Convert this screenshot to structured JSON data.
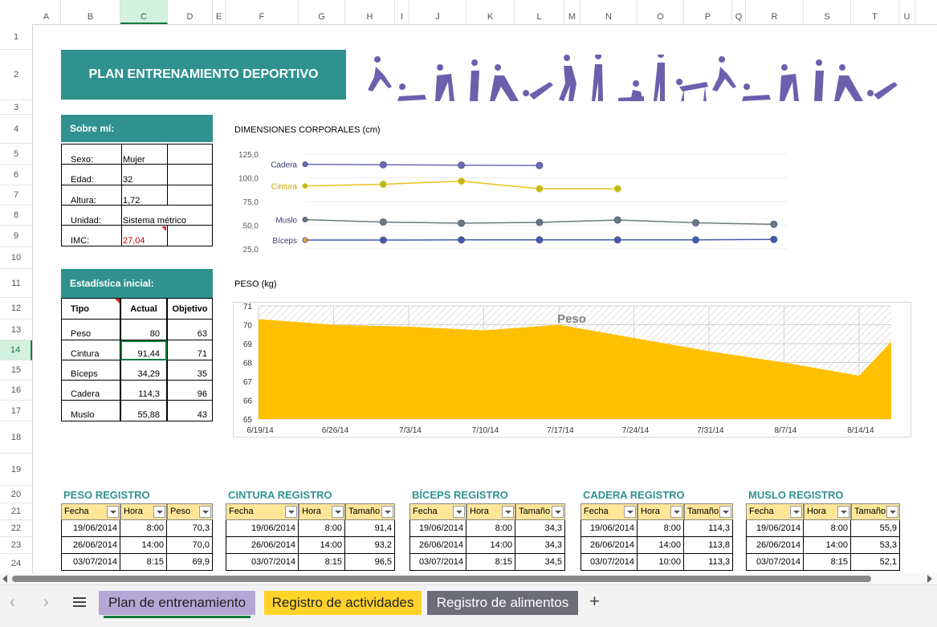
{
  "columns": [
    "A",
    "B",
    "C",
    "D",
    "E",
    "F",
    "G",
    "H",
    "I",
    "J",
    "K",
    "L",
    "M",
    "N",
    "O",
    "P",
    "Q",
    "R",
    "S",
    "T",
    "U"
  ],
  "rows": [
    "1",
    "2",
    "3",
    "4",
    "5",
    "6",
    "7",
    "8",
    "9",
    "10",
    "11",
    "12",
    "13",
    "14",
    "15",
    "16",
    "17",
    "18",
    "19",
    "20",
    "21",
    "22",
    "23",
    "24"
  ],
  "banner": {
    "title": "PLAN ENTRENAMIENTO DEPORTIVO"
  },
  "about": {
    "title": "Sobre mí:",
    "rows": [
      {
        "label": "Sexo:",
        "value": "Mujer"
      },
      {
        "label": "Edad:",
        "value": "32"
      },
      {
        "label": "Altura:",
        "value": "1,72"
      },
      {
        "label": "Unidad:",
        "value": "Sistema métrico"
      },
      {
        "label": "IMC:",
        "value": "27,04"
      }
    ]
  },
  "stats": {
    "title": "Estadística inicial:",
    "headers": [
      "Tipo",
      "Actual",
      "Objetivo"
    ],
    "rows": [
      {
        "tipo": "Peso",
        "actual": "80",
        "objetivo": "63"
      },
      {
        "tipo": "Cintura",
        "actual": "91,44",
        "objetivo": "71"
      },
      {
        "tipo": "Bíceps",
        "actual": "34,29",
        "objetivo": "35"
      },
      {
        "tipo": "Cadera",
        "actual": "114,3",
        "objetivo": "96"
      },
      {
        "tipo": "Muslo",
        "actual": "55,88",
        "objetivo": "43"
      }
    ]
  },
  "chart_data": [
    {
      "type": "line",
      "title": "DIMENSIONES CORPORALES (cm)",
      "ylim": [
        25,
        125
      ],
      "yticks": [
        "125,0",
        "100,0",
        "75,0",
        "50,0",
        "25,0"
      ],
      "series": [
        {
          "name": "Cadera",
          "color": "#6a6ab8",
          "values": [
            114.3,
            113.8,
            113.3,
            113.0
          ]
        },
        {
          "name": "Cintura",
          "color": "#e8c21b",
          "values": [
            91.4,
            93.2,
            96.5,
            88.5,
            88.5
          ]
        },
        {
          "name": "Muslo",
          "color": "#6b7b7b",
          "values": [
            55.9,
            53.3,
            52.1,
            53.0,
            55.5,
            52.5,
            51.0
          ]
        },
        {
          "name": "Bíceps",
          "color": "#4658b0",
          "values": [
            34.3,
            34.3,
            34.5,
            34.5,
            34.5,
            34.5,
            35.0
          ]
        }
      ]
    },
    {
      "type": "area",
      "title": "PESO (kg)",
      "series_label": "Peso",
      "color": "#ffc000",
      "categories": [
        "6/19/14",
        "6/26/14",
        "7/3/14",
        "7/10/14",
        "7/17/14",
        "7/24/14",
        "7/31/14",
        "8/7/14",
        "8/14/14"
      ],
      "yticks": [
        "71",
        "70",
        "69",
        "68",
        "67",
        "66",
        "65"
      ],
      "ylim": [
        65,
        71
      ],
      "x": [
        0,
        7,
        14,
        21,
        28,
        35,
        42,
        49,
        56,
        59
      ],
      "values": [
        70.3,
        70.0,
        69.9,
        69.7,
        70.0,
        69.3,
        68.6,
        68.0,
        67.3,
        69.1
      ]
    }
  ],
  "registers": [
    {
      "title": "PESO REGISTRO",
      "headers": [
        "Fecha",
        "Hora",
        "Peso"
      ],
      "rows": [
        [
          "19/06/2014",
          "8:00",
          "70,3"
        ],
        [
          "26/06/2014",
          "14:00",
          "70,0"
        ],
        [
          "03/07/2014",
          "8:15",
          "69,9"
        ]
      ]
    },
    {
      "title": "CINTURA REGISTRO",
      "headers": [
        "Fecha",
        "Hora",
        "Tamaño"
      ],
      "rows": [
        [
          "19/06/2014",
          "8:00",
          "91,4"
        ],
        [
          "26/06/2014",
          "14:00",
          "93,2"
        ],
        [
          "03/07/2014",
          "8:15",
          "96,5"
        ]
      ]
    },
    {
      "title": "BÍCEPS REGISTRO",
      "headers": [
        "Fecha",
        "Hora",
        "Tamaño"
      ],
      "rows": [
        [
          "19/06/2014",
          "8:00",
          "34,3"
        ],
        [
          "26/06/2014",
          "14:00",
          "34,3"
        ],
        [
          "03/07/2014",
          "8:15",
          "34,5"
        ]
      ]
    },
    {
      "title": "CADERA REGISTRO",
      "headers": [
        "Fecha",
        "Hora",
        "Tamaño"
      ],
      "rows": [
        [
          "19/06/2014",
          "8:00",
          "114,3"
        ],
        [
          "26/06/2014",
          "14:00",
          "113,8"
        ],
        [
          "03/07/2014",
          "10:00",
          "113,3"
        ]
      ]
    },
    {
      "title": "MUSLO REGISTRO",
      "headers": [
        "Fecha",
        "Hora",
        "Tamaño"
      ],
      "rows": [
        [
          "19/06/2014",
          "8:00",
          "55,9"
        ],
        [
          "26/06/2014",
          "14:00",
          "53,3"
        ],
        [
          "03/07/2014",
          "8:15",
          "52,1"
        ]
      ]
    }
  ],
  "tabs": [
    {
      "label": "Plan de entrenamiento",
      "bg": "#b4a7d6",
      "active": true
    },
    {
      "label": "Registro de actividades",
      "bg": "#ffd32a",
      "active": false
    },
    {
      "label": "Registro de alimentos",
      "bg": "#6d6d7a",
      "active": false
    }
  ],
  "icons": {
    "prev": "chevron-left-icon",
    "next": "chevron-right-icon",
    "menu": "hamburger-icon",
    "add": "plus-icon",
    "figures": "exercise-figures-icon"
  }
}
